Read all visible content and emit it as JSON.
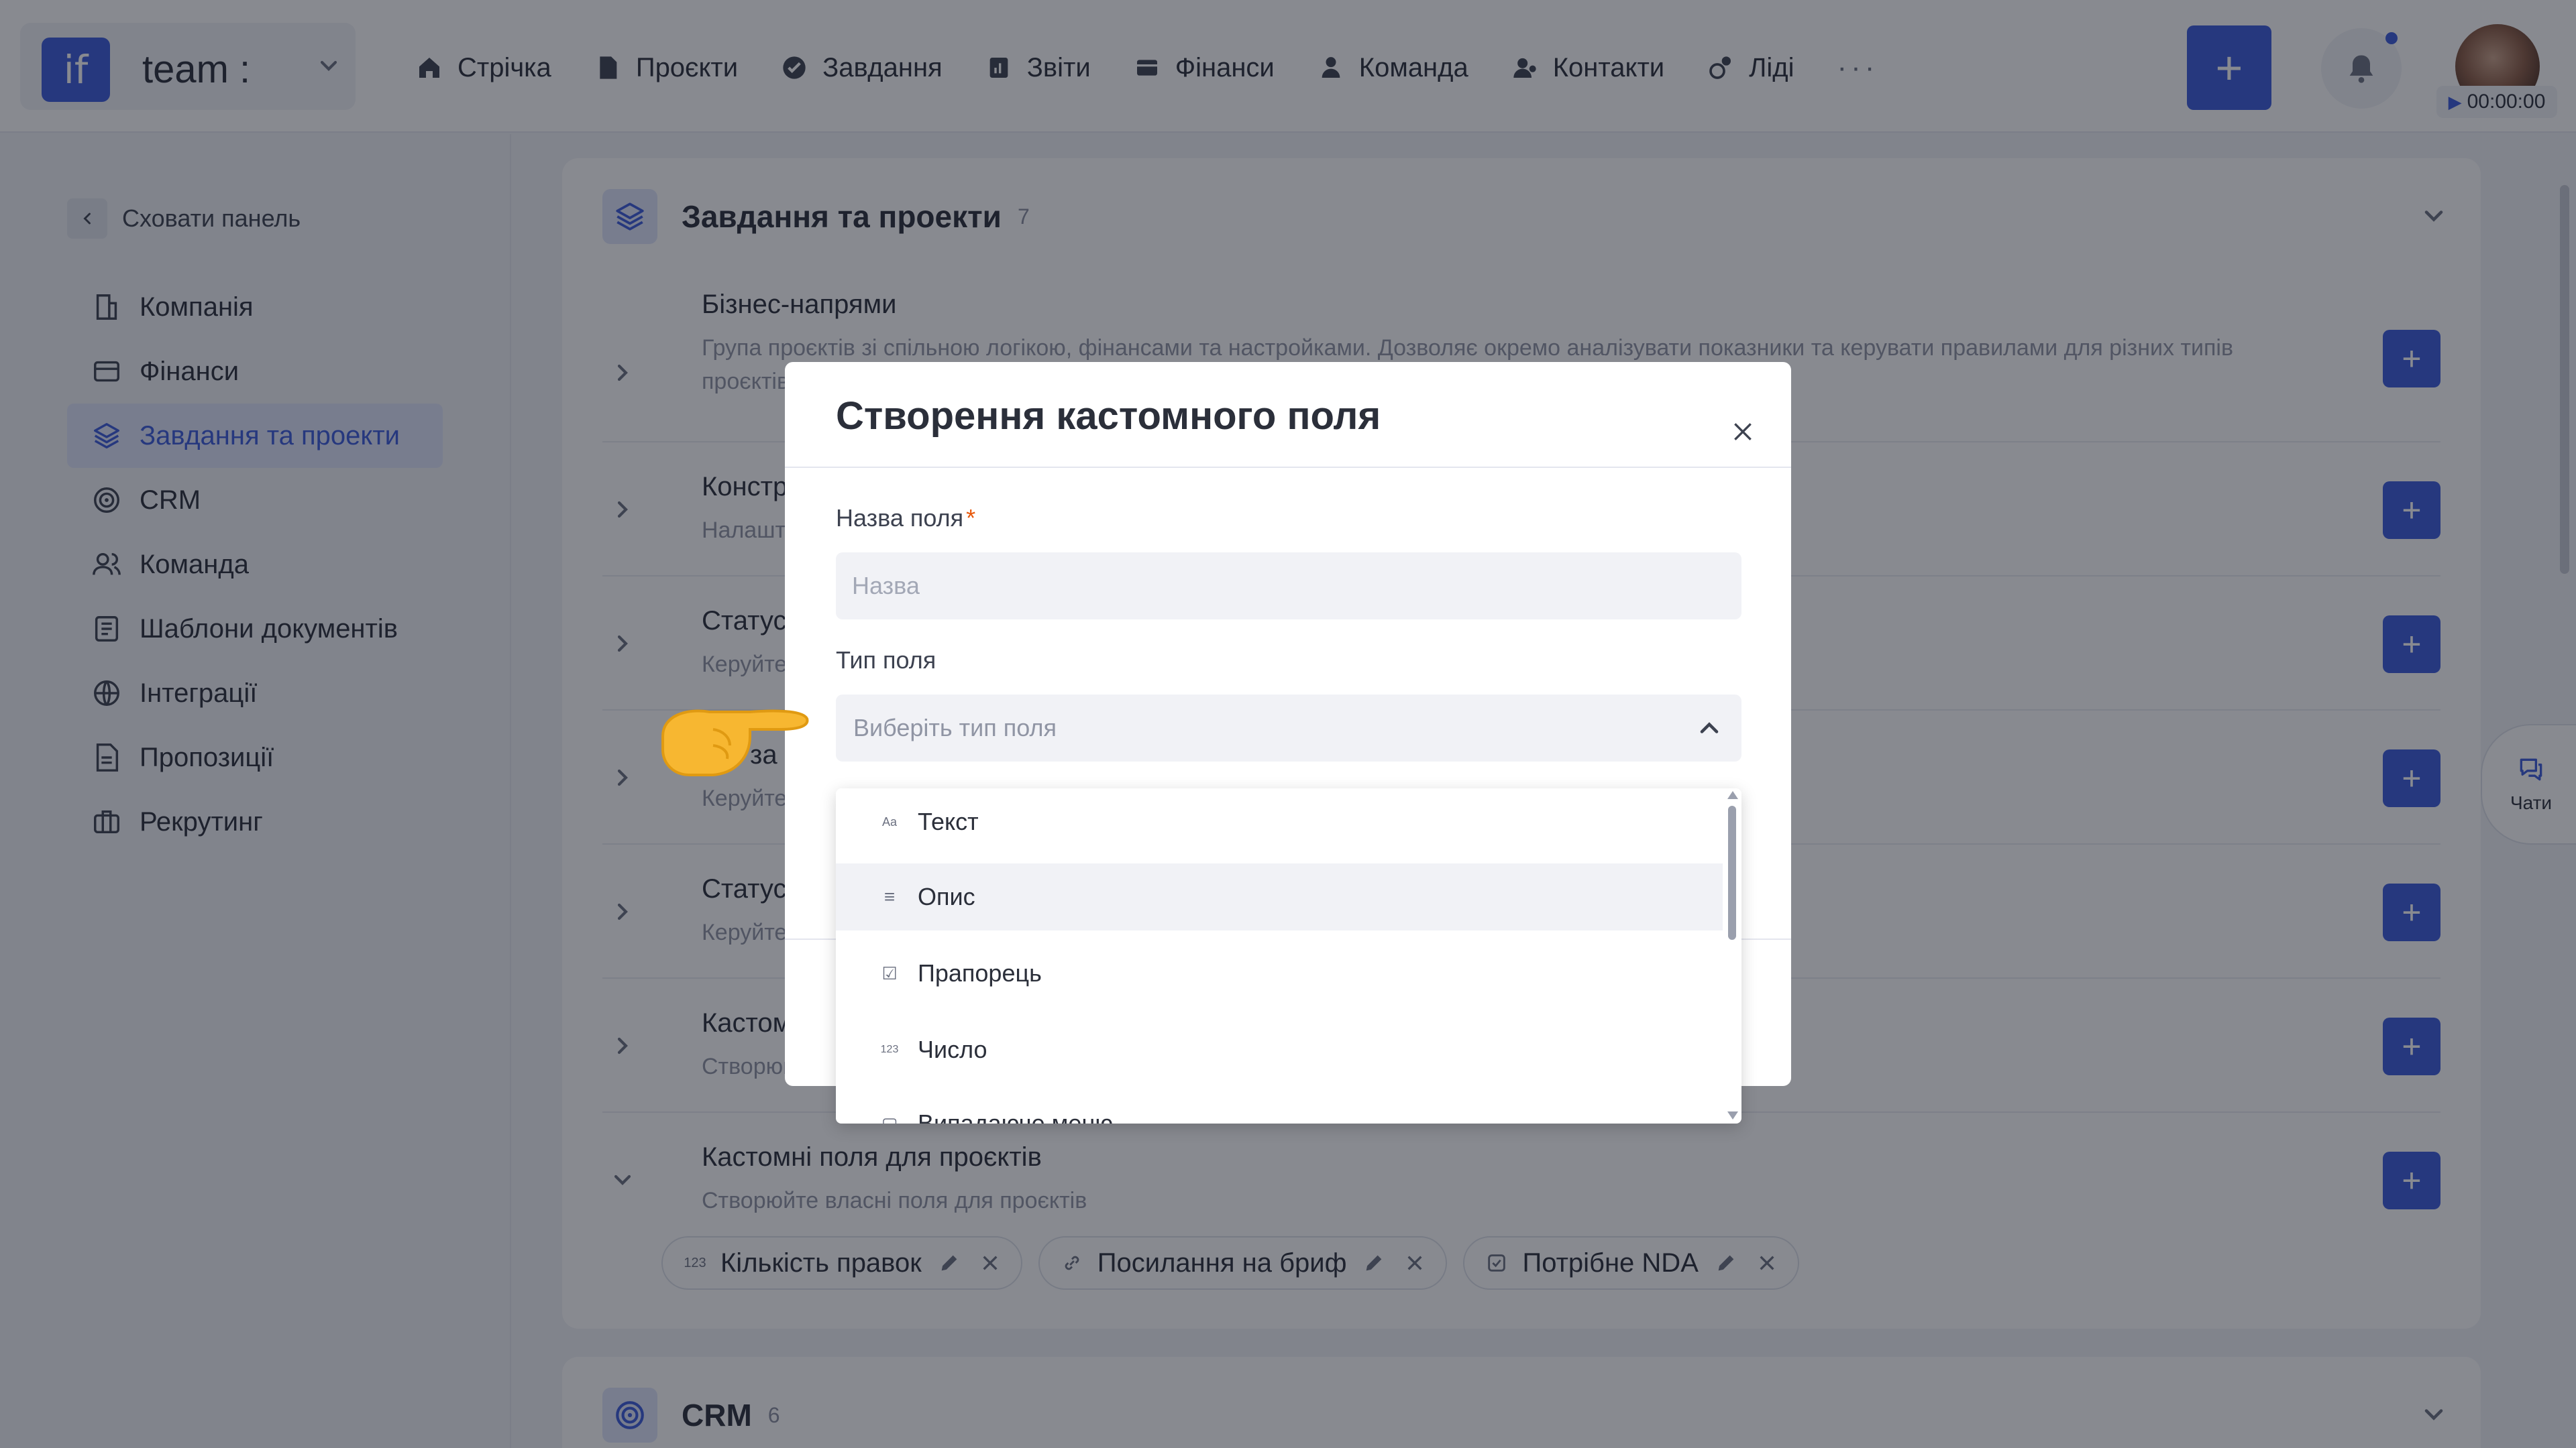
{
  "topbar": {
    "brand_logo": "if",
    "brand_name": "team :",
    "nav": [
      {
        "label": "Стрічка",
        "icon": "home-icon"
      },
      {
        "label": "Проєкти",
        "icon": "document-icon"
      },
      {
        "label": "Завдання",
        "icon": "check-circle-icon"
      },
      {
        "label": "Звіти",
        "icon": "chart-icon"
      },
      {
        "label": "Фінанси",
        "icon": "wallet-icon"
      },
      {
        "label": "Команда",
        "icon": "person-icon"
      },
      {
        "label": "Контакти",
        "icon": "contacts-icon"
      },
      {
        "label": "Ліді",
        "icon": "leads-icon"
      }
    ],
    "more": "···",
    "add": "+",
    "timer": "00:00:00"
  },
  "sidebar": {
    "hide_label": "Сховати панель",
    "items": [
      {
        "label": "Компанія",
        "icon": "company-icon"
      },
      {
        "label": "Фінанси",
        "icon": "card-icon"
      },
      {
        "label": "Завдання та проекти",
        "icon": "layers-icon",
        "active": true
      },
      {
        "label": "CRM",
        "icon": "target-icon"
      },
      {
        "label": "Команда",
        "icon": "people-icon"
      },
      {
        "label": "Шаблони документів",
        "icon": "document-template-icon"
      },
      {
        "label": "Інтеграції",
        "icon": "globe-icon"
      },
      {
        "label": "Пропозиції",
        "icon": "proposal-icon"
      },
      {
        "label": "Рекрутинг",
        "icon": "briefcase-icon"
      }
    ]
  },
  "main": {
    "section_title": "Завдання та проекти",
    "section_count": "7",
    "rows": [
      {
        "title": "Бізнес-напрями",
        "desc": "Група проєктів зі спільною логікою, фінансами та настройками. Дозволяє окремо аналізувати показники та керувати правилами для різних типів проєктів."
      },
      {
        "title": "Конструкт",
        "desc": "Налаштуйт"
      },
      {
        "title": "Статуси п",
        "desc": "Керуйте ст"
      },
      {
        "title": "за",
        "desc": "Керуйте ст"
      },
      {
        "title": "Статуси і",
        "desc": "Керуйте ст"
      },
      {
        "title": "Кастомні",
        "desc": "Створюйте"
      },
      {
        "title": "Кастомні поля для проєктів",
        "desc": "Створюйте власні поля для проєктів"
      }
    ],
    "tags": [
      {
        "label": "Кількість правок",
        "icon": "number-icon",
        "glyph": "123"
      },
      {
        "label": "Посилання на бриф",
        "icon": "link-icon",
        "glyph": "🔗"
      },
      {
        "label": "Потрібне NDA",
        "icon": "checkbox-icon",
        "glyph": "☑"
      }
    ],
    "row_add": "+",
    "crm_title": "CRM",
    "crm_count": "6"
  },
  "chat": {
    "label": "Чати"
  },
  "modal": {
    "title": "Створення кастомного поля",
    "name_label": "Назва поля",
    "required_mark": "*",
    "name_placeholder": "Назва",
    "type_label": "Тип поля",
    "type_placeholder": "Виберіть тип поля",
    "options": [
      {
        "label": "Текст",
        "icon": "text-icon",
        "glyph": "Aa"
      },
      {
        "label": "Опис",
        "icon": "paragraph-icon",
        "glyph": "≡"
      },
      {
        "label": "Прапорець",
        "icon": "checkbox-icon",
        "glyph": "☑"
      },
      {
        "label": "Число",
        "icon": "number-icon",
        "glyph": "123"
      },
      {
        "label": "Випадаюче меню",
        "icon": "dropdown-icon",
        "glyph": "▢"
      }
    ]
  },
  "pointer": {
    "icon": "pointing-hand-icon"
  }
}
